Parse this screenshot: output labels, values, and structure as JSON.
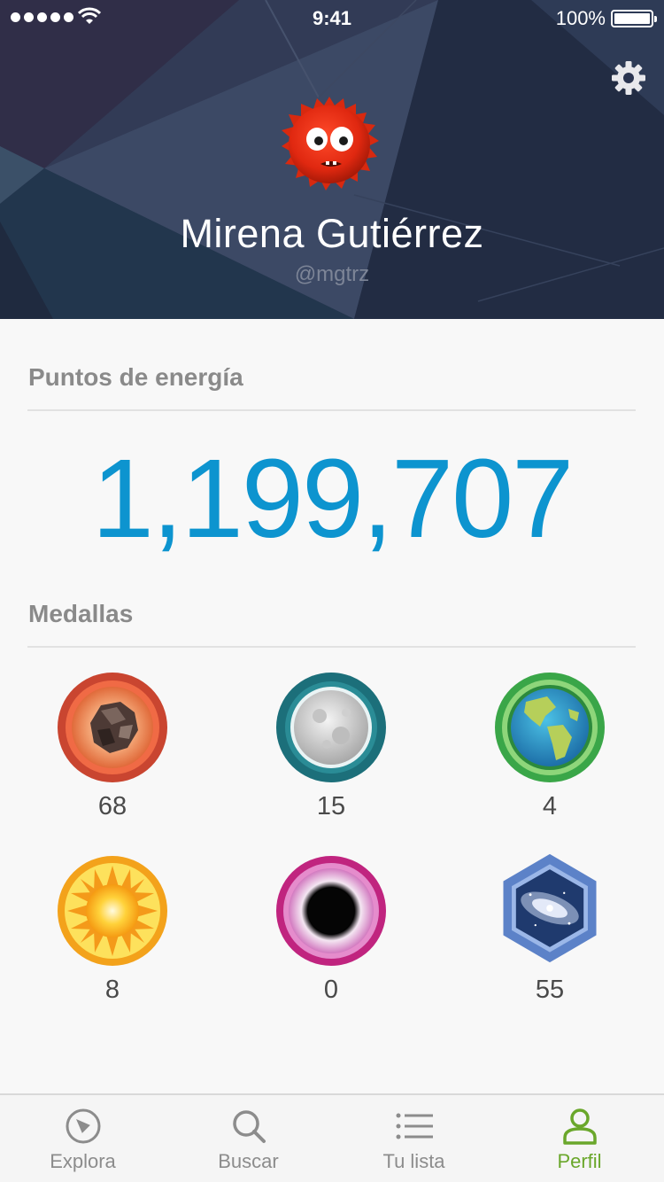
{
  "status_bar": {
    "time": "9:41",
    "battery": "100%"
  },
  "profile": {
    "name": "Mirena Gutiérrez",
    "handle": "@mgtrz",
    "avatar_icon": "red-fuzzy-monster-avatar",
    "settings_icon": "gear-icon"
  },
  "energy": {
    "title": "Puntos de energía",
    "value": "1,199,707"
  },
  "medals": {
    "title": "Medallas",
    "items": [
      {
        "icon": "asteroid-medal-icon",
        "count": "68"
      },
      {
        "icon": "moon-medal-icon",
        "count": "15"
      },
      {
        "icon": "earth-medal-icon",
        "count": "4"
      },
      {
        "icon": "sun-medal-icon",
        "count": "8"
      },
      {
        "icon": "black-hole-medal-icon",
        "count": "0"
      },
      {
        "icon": "galaxy-medal-icon",
        "count": "55"
      }
    ]
  },
  "tabs": [
    {
      "label": "Explora",
      "icon": "compass-icon",
      "active": false
    },
    {
      "label": "Buscar",
      "icon": "search-icon",
      "active": false
    },
    {
      "label": "Tu lista",
      "icon": "list-icon",
      "active": false
    },
    {
      "label": "Perfil",
      "icon": "person-icon",
      "active": true
    }
  ],
  "colors": {
    "header_bg": "#27324a",
    "points": "#0d94cf",
    "active_tab": "#6aa72b"
  }
}
